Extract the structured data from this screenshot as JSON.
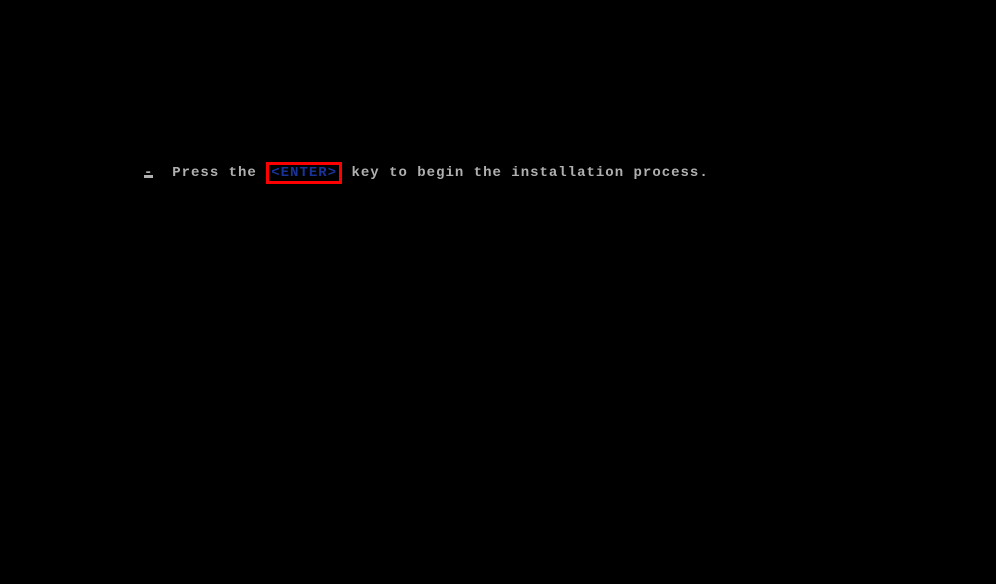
{
  "prompt": {
    "bullet": "-",
    "text_before": "Press the",
    "enter_label": "<ENTER>",
    "text_after": "key to begin the installation process."
  }
}
